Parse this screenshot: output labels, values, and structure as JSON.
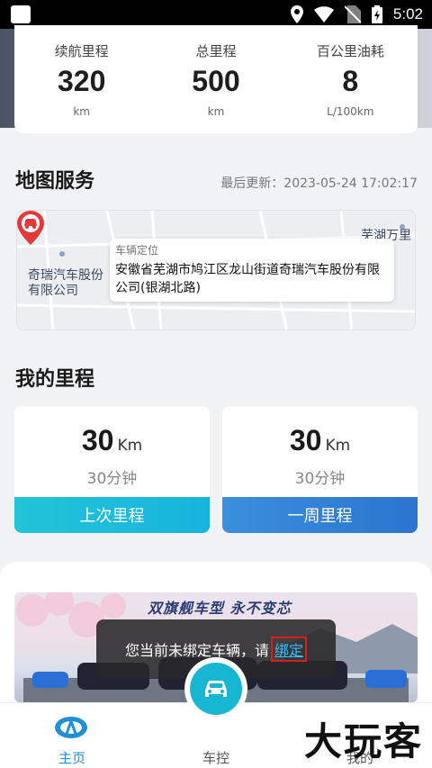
{
  "status_bar": {
    "time": "5:02"
  },
  "stats": [
    {
      "label": "续航里程",
      "value": "320",
      "unit": "km"
    },
    {
      "label": "总里程",
      "value": "500",
      "unit": "km"
    },
    {
      "label": "百公里油耗",
      "value": "8",
      "unit": "L/100km"
    }
  ],
  "map_service": {
    "title": "地图服务",
    "last_update": "最后更新：2023-05-24 17:02:17",
    "poi_left": "奇瑞汽车股份有限公司",
    "poi_right": "芜湖万里有限",
    "callout_title": "车辆定位",
    "callout_address": "安徽省芜湖市鸠江区龙山街道奇瑞汽车股份有限公司(银湖北路)"
  },
  "mileage": {
    "title": "我的里程",
    "last": {
      "value": "30",
      "unit": "Km",
      "duration": "30分钟",
      "button": "上次里程"
    },
    "week": {
      "value": "30",
      "unit": "Km",
      "duration": "30分钟",
      "button": "一周里程"
    }
  },
  "banner": {
    "tagline": "双旗舰车型 永不变芯",
    "toast_text": "您当前未绑定车辆，请",
    "toast_link": "绑定"
  },
  "nav": {
    "home": "主页",
    "control": "车控",
    "mine": "我的"
  },
  "watermark": "大玩客",
  "colors": {
    "accent": "#17b7d3",
    "nav_active": "#1f8fd6",
    "link": "#33c0ff",
    "highlight": "#d81e1e"
  }
}
